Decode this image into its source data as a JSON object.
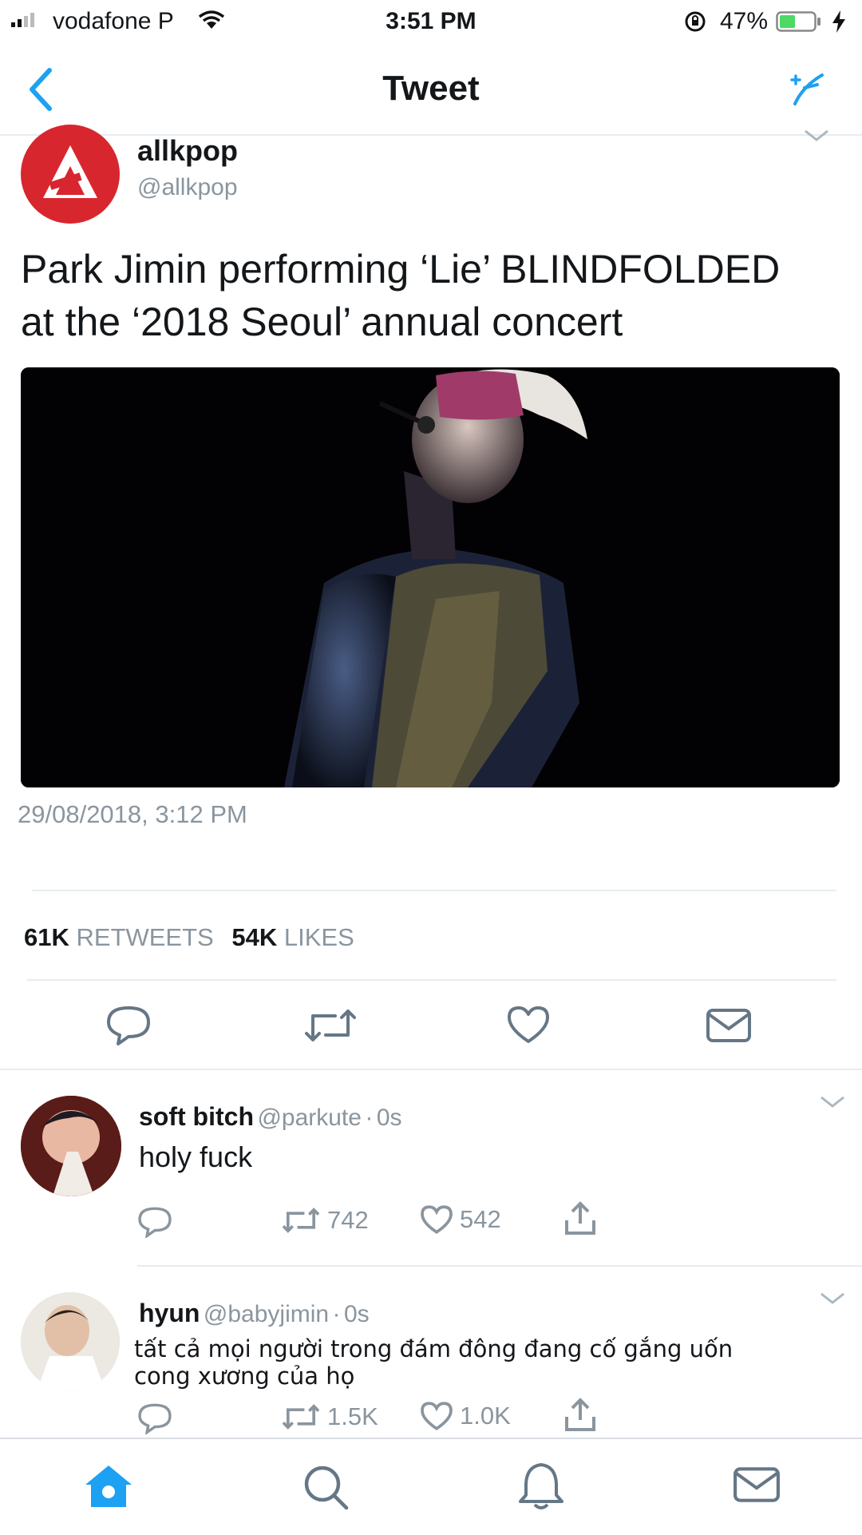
{
  "status_bar": {
    "carrier": "vodafone P",
    "time": "3:51 PM",
    "battery": "47%",
    "battery_level": 0.47
  },
  "nav": {
    "title": "Tweet",
    "back_icon": "chevron-left-icon",
    "compose_icon": "compose-tweet-icon"
  },
  "tweet": {
    "author_name": "allkpop",
    "author_handle": "@allkpop",
    "text_line1": "Park Jimin performing ‘Lie’ BLINDFOLDED",
    "text_line2": "at the ‘2018 Seoul’ annual concert",
    "timestamp": "29/08/2018, 3:12 PM",
    "retweets_count": "61K",
    "retweets_label": "RETWEETS",
    "likes_count": "54K",
    "likes_label": "LIKES"
  },
  "replies": [
    {
      "name": "soft bitch",
      "handle": "@parkute",
      "time": "0s",
      "text": "holy fuck",
      "retweets": "742",
      "likes": "542"
    },
    {
      "name": "hyun",
      "handle": "@babyjimin",
      "time": "0s",
      "text": "tất cả mọi người trong đám đông đang cố gắng uốn cong xương của họ",
      "retweets": "1.5K",
      "likes": "1.0K"
    }
  ],
  "colors": {
    "accent": "#1da1f2",
    "brand_red": "#d8262e",
    "gray_text": "#8a959e",
    "divider": "#e6ecf0"
  }
}
